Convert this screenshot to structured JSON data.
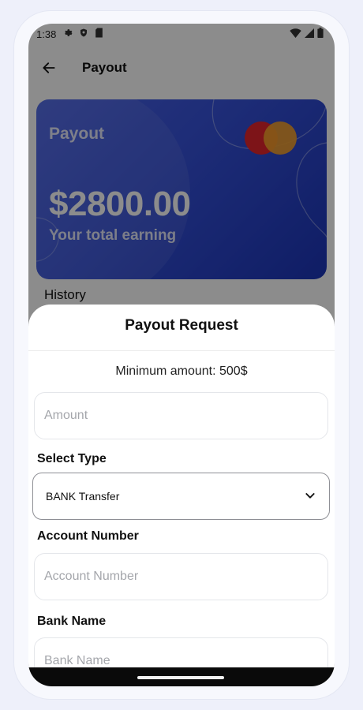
{
  "status_bar": {
    "time": "1:38",
    "icons": [
      "settings-gear-icon",
      "shield-icon",
      "sd-card-icon",
      "wifi-icon",
      "cellular-icon",
      "battery-icon"
    ]
  },
  "appbar": {
    "title": "Payout",
    "back_icon": "arrow-left-icon"
  },
  "card": {
    "label": "Payout",
    "amount": "$2800.00",
    "subtitle": "Your total earning",
    "brand_icon": "mastercard-logo"
  },
  "history_label": "History",
  "sheet": {
    "title": "Payout Request",
    "min_amount": "Minimum amount: 500$",
    "amount_placeholder": "Amount",
    "select_type_label": "Select Type",
    "select_type_value": "BANK Transfer",
    "account_number_label": "Account Number",
    "account_number_placeholder": "Account Number",
    "bank_name_label": "Bank Name",
    "bank_name_placeholder": "Bank Name"
  },
  "colors": {
    "card_gradient_start": "#4a63e6",
    "card_gradient_end": "#1c35b8",
    "mastercard_red": "#e3262d",
    "mastercard_yellow": "#f5a12a",
    "scrim": "rgba(0,0,0,0.45)"
  }
}
